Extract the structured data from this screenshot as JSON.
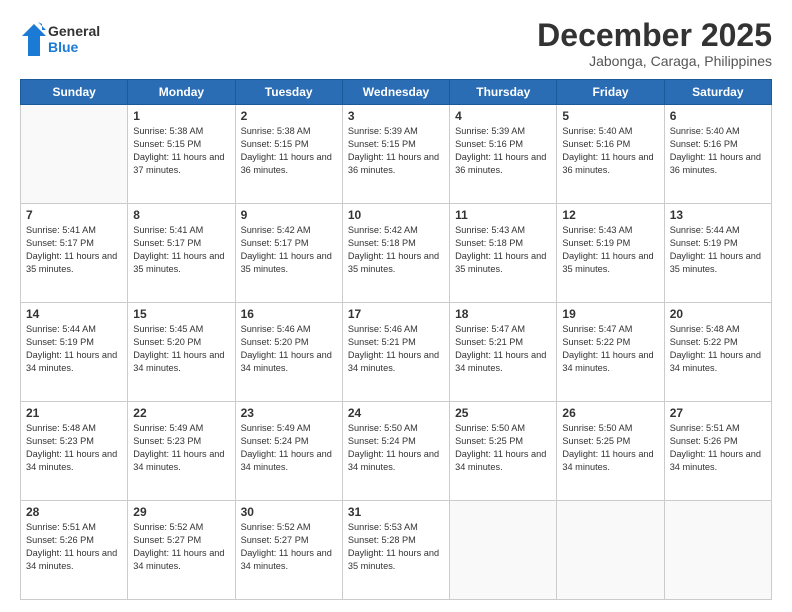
{
  "header": {
    "logo_general": "General",
    "logo_blue": "Blue",
    "month": "December 2025",
    "location": "Jabonga, Caraga, Philippines"
  },
  "weekdays": [
    "Sunday",
    "Monday",
    "Tuesday",
    "Wednesday",
    "Thursday",
    "Friday",
    "Saturday"
  ],
  "weeks": [
    [
      {
        "day": "",
        "sunrise": "",
        "sunset": "",
        "daylight": ""
      },
      {
        "day": "1",
        "sunrise": "Sunrise: 5:38 AM",
        "sunset": "Sunset: 5:15 PM",
        "daylight": "Daylight: 11 hours and 37 minutes."
      },
      {
        "day": "2",
        "sunrise": "Sunrise: 5:38 AM",
        "sunset": "Sunset: 5:15 PM",
        "daylight": "Daylight: 11 hours and 36 minutes."
      },
      {
        "day": "3",
        "sunrise": "Sunrise: 5:39 AM",
        "sunset": "Sunset: 5:15 PM",
        "daylight": "Daylight: 11 hours and 36 minutes."
      },
      {
        "day": "4",
        "sunrise": "Sunrise: 5:39 AM",
        "sunset": "Sunset: 5:16 PM",
        "daylight": "Daylight: 11 hours and 36 minutes."
      },
      {
        "day": "5",
        "sunrise": "Sunrise: 5:40 AM",
        "sunset": "Sunset: 5:16 PM",
        "daylight": "Daylight: 11 hours and 36 minutes."
      },
      {
        "day": "6",
        "sunrise": "Sunrise: 5:40 AM",
        "sunset": "Sunset: 5:16 PM",
        "daylight": "Daylight: 11 hours and 36 minutes."
      }
    ],
    [
      {
        "day": "7",
        "sunrise": "Sunrise: 5:41 AM",
        "sunset": "Sunset: 5:17 PM",
        "daylight": "Daylight: 11 hours and 35 minutes."
      },
      {
        "day": "8",
        "sunrise": "Sunrise: 5:41 AM",
        "sunset": "Sunset: 5:17 PM",
        "daylight": "Daylight: 11 hours and 35 minutes."
      },
      {
        "day": "9",
        "sunrise": "Sunrise: 5:42 AM",
        "sunset": "Sunset: 5:17 PM",
        "daylight": "Daylight: 11 hours and 35 minutes."
      },
      {
        "day": "10",
        "sunrise": "Sunrise: 5:42 AM",
        "sunset": "Sunset: 5:18 PM",
        "daylight": "Daylight: 11 hours and 35 minutes."
      },
      {
        "day": "11",
        "sunrise": "Sunrise: 5:43 AM",
        "sunset": "Sunset: 5:18 PM",
        "daylight": "Daylight: 11 hours and 35 minutes."
      },
      {
        "day": "12",
        "sunrise": "Sunrise: 5:43 AM",
        "sunset": "Sunset: 5:19 PM",
        "daylight": "Daylight: 11 hours and 35 minutes."
      },
      {
        "day": "13",
        "sunrise": "Sunrise: 5:44 AM",
        "sunset": "Sunset: 5:19 PM",
        "daylight": "Daylight: 11 hours and 35 minutes."
      }
    ],
    [
      {
        "day": "14",
        "sunrise": "Sunrise: 5:44 AM",
        "sunset": "Sunset: 5:19 PM",
        "daylight": "Daylight: 11 hours and 34 minutes."
      },
      {
        "day": "15",
        "sunrise": "Sunrise: 5:45 AM",
        "sunset": "Sunset: 5:20 PM",
        "daylight": "Daylight: 11 hours and 34 minutes."
      },
      {
        "day": "16",
        "sunrise": "Sunrise: 5:46 AM",
        "sunset": "Sunset: 5:20 PM",
        "daylight": "Daylight: 11 hours and 34 minutes."
      },
      {
        "day": "17",
        "sunrise": "Sunrise: 5:46 AM",
        "sunset": "Sunset: 5:21 PM",
        "daylight": "Daylight: 11 hours and 34 minutes."
      },
      {
        "day": "18",
        "sunrise": "Sunrise: 5:47 AM",
        "sunset": "Sunset: 5:21 PM",
        "daylight": "Daylight: 11 hours and 34 minutes."
      },
      {
        "day": "19",
        "sunrise": "Sunrise: 5:47 AM",
        "sunset": "Sunset: 5:22 PM",
        "daylight": "Daylight: 11 hours and 34 minutes."
      },
      {
        "day": "20",
        "sunrise": "Sunrise: 5:48 AM",
        "sunset": "Sunset: 5:22 PM",
        "daylight": "Daylight: 11 hours and 34 minutes."
      }
    ],
    [
      {
        "day": "21",
        "sunrise": "Sunrise: 5:48 AM",
        "sunset": "Sunset: 5:23 PM",
        "daylight": "Daylight: 11 hours and 34 minutes."
      },
      {
        "day": "22",
        "sunrise": "Sunrise: 5:49 AM",
        "sunset": "Sunset: 5:23 PM",
        "daylight": "Daylight: 11 hours and 34 minutes."
      },
      {
        "day": "23",
        "sunrise": "Sunrise: 5:49 AM",
        "sunset": "Sunset: 5:24 PM",
        "daylight": "Daylight: 11 hours and 34 minutes."
      },
      {
        "day": "24",
        "sunrise": "Sunrise: 5:50 AM",
        "sunset": "Sunset: 5:24 PM",
        "daylight": "Daylight: 11 hours and 34 minutes."
      },
      {
        "day": "25",
        "sunrise": "Sunrise: 5:50 AM",
        "sunset": "Sunset: 5:25 PM",
        "daylight": "Daylight: 11 hours and 34 minutes."
      },
      {
        "day": "26",
        "sunrise": "Sunrise: 5:50 AM",
        "sunset": "Sunset: 5:25 PM",
        "daylight": "Daylight: 11 hours and 34 minutes."
      },
      {
        "day": "27",
        "sunrise": "Sunrise: 5:51 AM",
        "sunset": "Sunset: 5:26 PM",
        "daylight": "Daylight: 11 hours and 34 minutes."
      }
    ],
    [
      {
        "day": "28",
        "sunrise": "Sunrise: 5:51 AM",
        "sunset": "Sunset: 5:26 PM",
        "daylight": "Daylight: 11 hours and 34 minutes."
      },
      {
        "day": "29",
        "sunrise": "Sunrise: 5:52 AM",
        "sunset": "Sunset: 5:27 PM",
        "daylight": "Daylight: 11 hours and 34 minutes."
      },
      {
        "day": "30",
        "sunrise": "Sunrise: 5:52 AM",
        "sunset": "Sunset: 5:27 PM",
        "daylight": "Daylight: 11 hours and 34 minutes."
      },
      {
        "day": "31",
        "sunrise": "Sunrise: 5:53 AM",
        "sunset": "Sunset: 5:28 PM",
        "daylight": "Daylight: 11 hours and 35 minutes."
      },
      {
        "day": "",
        "sunrise": "",
        "sunset": "",
        "daylight": ""
      },
      {
        "day": "",
        "sunrise": "",
        "sunset": "",
        "daylight": ""
      },
      {
        "day": "",
        "sunrise": "",
        "sunset": "",
        "daylight": ""
      }
    ]
  ]
}
